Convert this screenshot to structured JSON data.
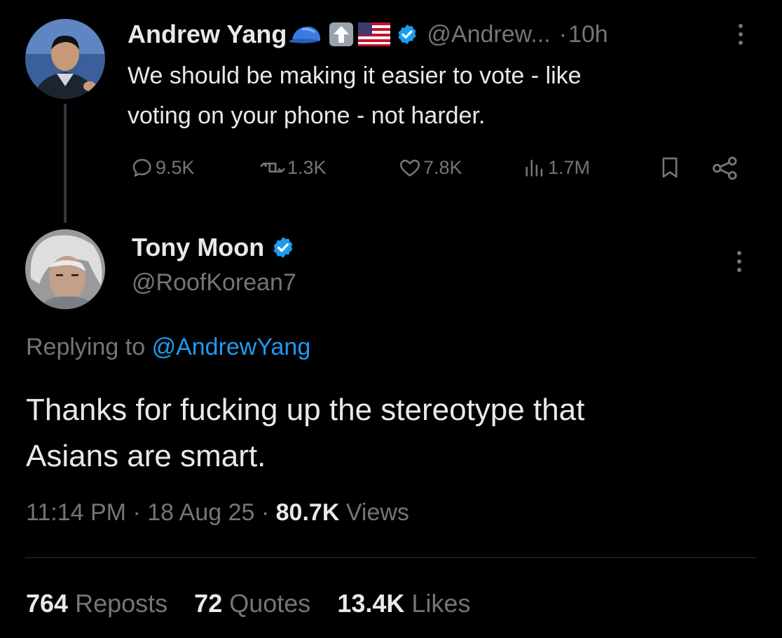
{
  "original_tweet": {
    "author_name": "Andrew Yang",
    "handle": "@Andrew...",
    "time_sep": "·",
    "time": "10h",
    "text_line1": "We should be making it easier to vote - like",
    "text_line2": "voting on your phone - not harder.",
    "emoji_icons": [
      "blue-cap-icon",
      "up-arrow-icon",
      "us-flag-icon",
      "verified-badge-icon"
    ],
    "stats": {
      "replies": "9.5K",
      "reposts": "1.3K",
      "likes": "7.8K",
      "views": "1.7M"
    }
  },
  "reply_tweet": {
    "author_name": "Tony Moon",
    "handle": "@RoofKorean7",
    "replying_prefix": "Replying to",
    "replying_handle": "@AndrewYang",
    "text_line1": "Thanks for fucking up the stereotype that",
    "text_line2": "Asians are smart.",
    "time": "11:14 PM",
    "sep1": "·",
    "date": "18 Aug 25",
    "sep2": "·",
    "views_count": "80.7K",
    "views_label": "Views"
  },
  "engagement": {
    "reposts_count": "764",
    "reposts_label": "Reposts",
    "quotes_count": "72",
    "quotes_label": "Quotes",
    "likes_count": "13.4K",
    "likes_label": "Likes"
  },
  "colors": {
    "background": "#000000",
    "text": "#e7e9ea",
    "muted": "#71767b",
    "accent": "#1d9bf0"
  }
}
